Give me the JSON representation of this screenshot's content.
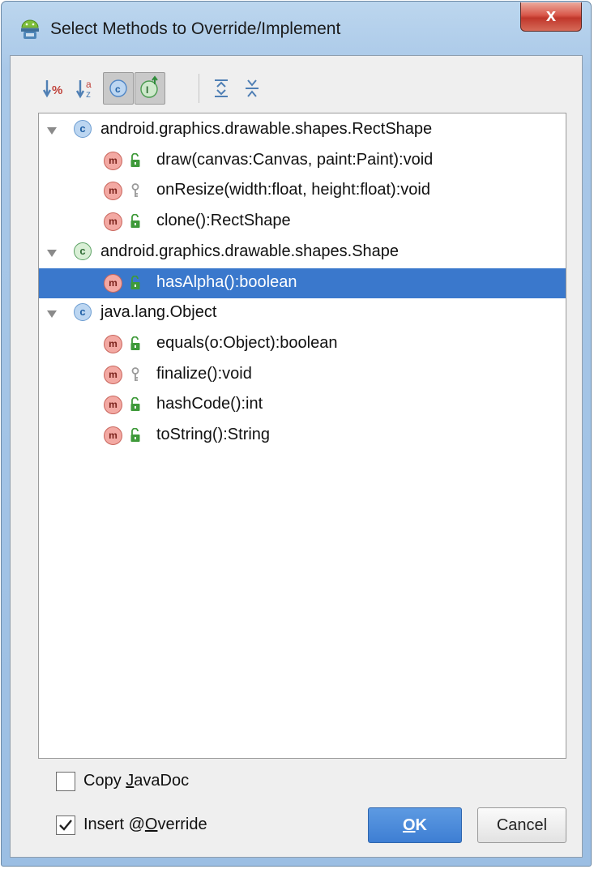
{
  "window": {
    "title": "Select Methods to Override/Implement",
    "close_label": "x"
  },
  "toolbar": {
    "buttons": [
      {
        "icon": "sort-by-percent-icon",
        "pressed": false
      },
      {
        "icon": "sort-alphabetically-icon",
        "pressed": false
      },
      {
        "icon": "show-classes-icon",
        "pressed": true
      },
      {
        "icon": "show-interfaces-icon",
        "pressed": true
      },
      {
        "icon": "expand-all-icon",
        "pressed": false
      },
      {
        "icon": "collapse-all-icon",
        "pressed": false
      }
    ]
  },
  "tree": {
    "rows": [
      {
        "kind": "class",
        "label": "android.graphics.drawable.shapes.RectShape",
        "icon": "class-icon"
      },
      {
        "kind": "method",
        "label": "draw(canvas:Canvas, paint:Paint):void",
        "visibility": "public"
      },
      {
        "kind": "method",
        "label": "onResize(width:float, height:float):void",
        "visibility": "protected"
      },
      {
        "kind": "method",
        "label": "clone():RectShape",
        "visibility": "public"
      },
      {
        "kind": "class",
        "label": "android.graphics.drawable.shapes.Shape",
        "icon": "abstract-class-icon"
      },
      {
        "kind": "method",
        "label": "hasAlpha():boolean",
        "visibility": "public",
        "selected": true
      },
      {
        "kind": "class",
        "label": "java.lang.Object",
        "icon": "class-icon"
      },
      {
        "kind": "method",
        "label": "equals(o:Object):boolean",
        "visibility": "public"
      },
      {
        "kind": "method",
        "label": "finalize():void",
        "visibility": "protected"
      },
      {
        "kind": "method",
        "label": "hashCode():int",
        "visibility": "public"
      },
      {
        "kind": "method",
        "label": "toString():String",
        "visibility": "public"
      }
    ],
    "class_letter": "c",
    "method_letter": "m"
  },
  "options": {
    "copy_javadoc": {
      "prefix": "Copy ",
      "mnemonic": "J",
      "suffix": "avaDoc",
      "checked": false
    },
    "insert_override": {
      "prefix": "Insert @",
      "mnemonic": "O",
      "suffix": "verride",
      "checked": true
    }
  },
  "buttons": {
    "ok": {
      "prefix": "",
      "mnemonic": "O",
      "suffix": "K"
    },
    "cancel": "Cancel"
  },
  "colors": {
    "selection": "#3a78cc",
    "accent_button": "#4a88d8",
    "method_icon": "#f3a9a3",
    "class_icon": "#bcd6f1",
    "public_lock": "#3f9a3a"
  }
}
